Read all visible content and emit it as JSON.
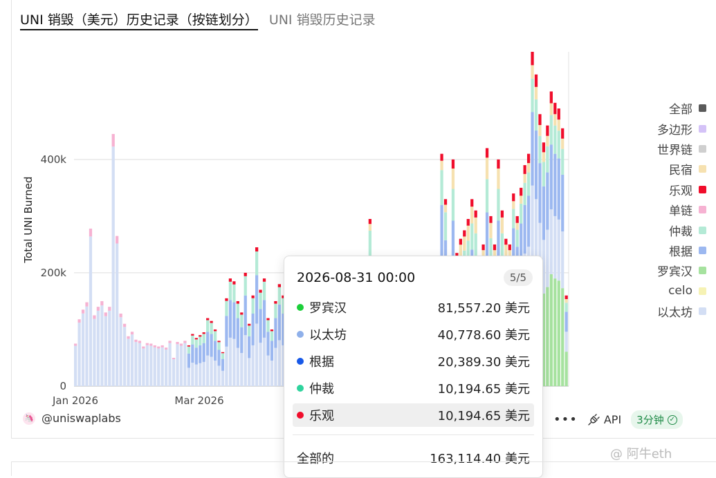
{
  "tabs": {
    "active": "UNI 销毁（美元）历史记录（按链划分）",
    "inactive": "UNI 销毁历史记录"
  },
  "chart_data": {
    "type": "bar",
    "stacked": true,
    "ylabel": "Total UNI Burned",
    "y_ticks": [
      "0",
      "200k",
      "400k"
    ],
    "y_tick_values": [
      0,
      200000,
      400000
    ],
    "ylim": [
      0,
      590000
    ],
    "x_ticks": [
      "Jan 2026",
      "Mar 2026"
    ],
    "grid": true,
    "legend_position": "right",
    "series_colors": {
      "以太坊": "#d3def4",
      "根据": "#9cb8f0",
      "仲裁": "#b4ead6",
      "民宿": "#f6e1b0",
      "乐观": "#f00d2b",
      "单链": "#f6b2d2",
      "罗宾汉": "#a6e29f",
      "celo": "#f6f2b4"
    },
    "daily_total_estimates": [
      75000,
      118000,
      135000,
      148000,
      278000,
      125000,
      140000,
      150000,
      130000,
      140000,
      445000,
      265000,
      128000,
      110000,
      88000,
      96000,
      82000,
      80000,
      70000,
      76000,
      75000,
      72000,
      70000,
      72000,
      68000,
      80000,
      50000,
      78000,
      75000,
      80000,
      72000,
      92000,
      85000,
      90000,
      95000,
      120000,
      115000,
      100000,
      80000,
      60000,
      155000,
      190000,
      185000,
      150000,
      130000,
      200000,
      110000,
      160000,
      245000,
      170000,
      190000,
      120000,
      100000,
      150000,
      180000,
      160000,
      140000,
      120000,
      100000,
      150000,
      215000,
      170000,
      130000,
      160000,
      180000,
      140000,
      100000,
      120000,
      170000,
      155000,
      195000,
      190000,
      160000,
      200000,
      130000,
      120000,
      160000,
      175000,
      295000,
      230000,
      190000,
      200000,
      160000,
      120000,
      140000,
      170000,
      150000,
      120000,
      140000,
      155000,
      160000,
      150000,
      140000,
      80000,
      150000,
      190000,
      220000,
      410000,
      330000,
      230000,
      400000,
      235000,
      260000,
      275000,
      295000,
      330000,
      310000,
      200000,
      250000,
      420000,
      300000,
      250000,
      400000,
      310000,
      260000,
      250000,
      340000,
      300000,
      350000,
      390000,
      410000,
      590000,
      550000,
      480000,
      430000,
      460000,
      520000,
      500000,
      490000,
      455000,
      160000
    ],
    "bar_count_note": "",
    "tooltip": {
      "date": "2026-08-31 00:00",
      "page": "5/5",
      "rows": [
        {
          "name": "罗宾汉",
          "value": "81,557.20 美元",
          "color": "#1ccf3a"
        },
        {
          "name": "以太坊",
          "value": "40,778.60 美元",
          "color": "#8fb0ea"
        },
        {
          "name": "根据",
          "value": "20,389.30 美元",
          "color": "#1759e8"
        },
        {
          "name": "仲裁",
          "value": "10,194.65 美元",
          "color": "#2fd39d"
        },
        {
          "name": "乐观",
          "value": "10,194.65 美元",
          "color": "#f00d2b"
        }
      ],
      "total_label": "全部的",
      "total_value": "163,114.40 美元"
    }
  },
  "legend": [
    {
      "name": "全部",
      "color": "#5a5a5a"
    },
    {
      "name": "多边形",
      "color": "#d4c2f7"
    },
    {
      "name": "世界链",
      "color": "#cfcfcf"
    },
    {
      "name": "民宿",
      "color": "#f6e1b0"
    },
    {
      "name": "乐观",
      "color": "#f00d2b"
    },
    {
      "name": "单链",
      "color": "#f6b2d2"
    },
    {
      "name": "仲裁",
      "color": "#b4ead6"
    },
    {
      "name": "根据",
      "color": "#9cb8f0"
    },
    {
      "name": "罗宾汉",
      "color": "#a6e29f"
    },
    {
      "name": "celo",
      "color": "#f6f2b4"
    },
    {
      "name": "以太坊",
      "color": "#d3def4"
    }
  ],
  "footer": {
    "author": "@uniswaplabs",
    "more": "•••",
    "api": "API",
    "refresh": "3分钟"
  },
  "watermark": "@ 阿牛eth"
}
